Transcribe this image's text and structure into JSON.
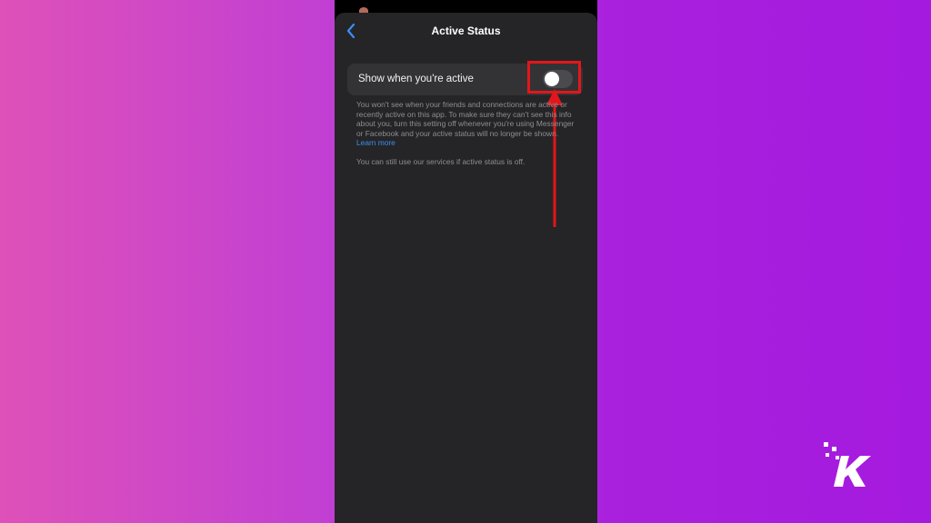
{
  "screen": {
    "title": "Active Status",
    "back_icon": "chevron-left-icon"
  },
  "setting": {
    "label": "Show when you're active",
    "toggle_on": false
  },
  "description": {
    "text": "You won't see when your friends and connections are active or recently active on this app. To make sure they can't see this info about you, turn this setting off whenever you're using Messenger or Facebook and your active status will no longer be shown.",
    "learn_more": "Learn more"
  },
  "note": "You can still use our services if active status is off.",
  "annotation": {
    "highlight_color": "#e3161b",
    "shape": "rectangle-and-arrow"
  },
  "watermark": {
    "brand": "K",
    "color": "#ffffff"
  },
  "colors": {
    "accent": "#3d8ef5",
    "sheet_background": "#252527",
    "row_background": "#333336"
  }
}
